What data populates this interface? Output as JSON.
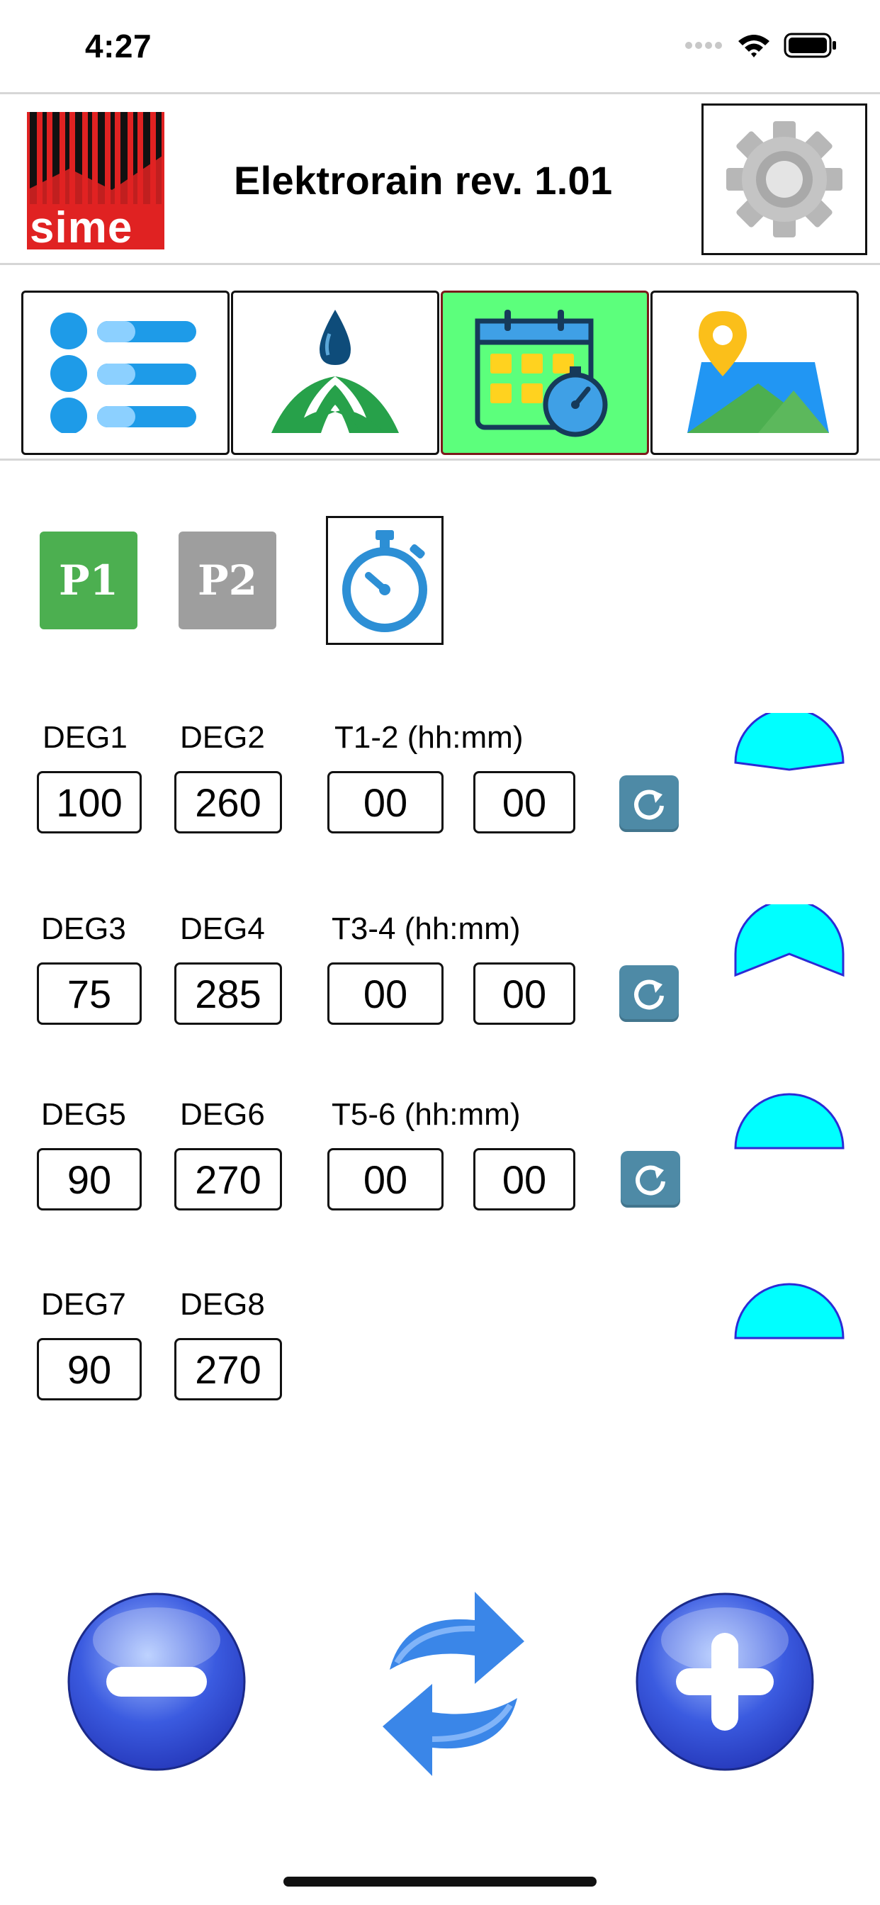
{
  "status_bar": {
    "time": "4:27",
    "icons": [
      "signal-icon",
      "wifi-icon",
      "battery-icon"
    ]
  },
  "header": {
    "logo_text": "sime",
    "title": "Elektrorain rev. 1.01",
    "settings_icon": "gear-icon"
  },
  "nav": {
    "tabs": [
      {
        "icon": "list-icon",
        "active": false
      },
      {
        "icon": "irrigation-icon",
        "active": false
      },
      {
        "icon": "calendar-timer-icon",
        "active": true
      },
      {
        "icon": "map-pin-icon",
        "active": false
      }
    ]
  },
  "programs": {
    "p1_label": "P1",
    "p2_label": "P2",
    "p1_color": "#4caf50",
    "p2_color": "#9e9e9e",
    "timer_icon": "stopwatch-icon"
  },
  "rows": [
    {
      "label_a": "DEG1",
      "label_b": "DEG2",
      "time_label": "T1-2 (hh:mm)",
      "deg_a": "100",
      "deg_b": "260",
      "hh": "00",
      "mm": "00"
    },
    {
      "label_a": "DEG3",
      "label_b": "DEG4",
      "time_label": "T3-4 (hh:mm)",
      "deg_a": "75",
      "deg_b": "285",
      "hh": "00",
      "mm": "00"
    },
    {
      "label_a": "DEG5",
      "label_b": "DEG6",
      "time_label": "T5-6 (hh:mm)",
      "deg_a": "90",
      "deg_b": "270",
      "hh": "00",
      "mm": "00"
    },
    {
      "label_a": "DEG7",
      "label_b": "DEG8",
      "deg_a": "90",
      "deg_b": "270"
    }
  ],
  "colors": {
    "sector_fill": "#00ffff",
    "sector_stroke": "#2b2bd6",
    "active_tab": "#5cff7c",
    "reset_button": "#4e8aa6"
  },
  "bottom": {
    "minus_icon": "minus-icon",
    "sync_icon": "sync-icon",
    "plus_icon": "plus-icon"
  }
}
